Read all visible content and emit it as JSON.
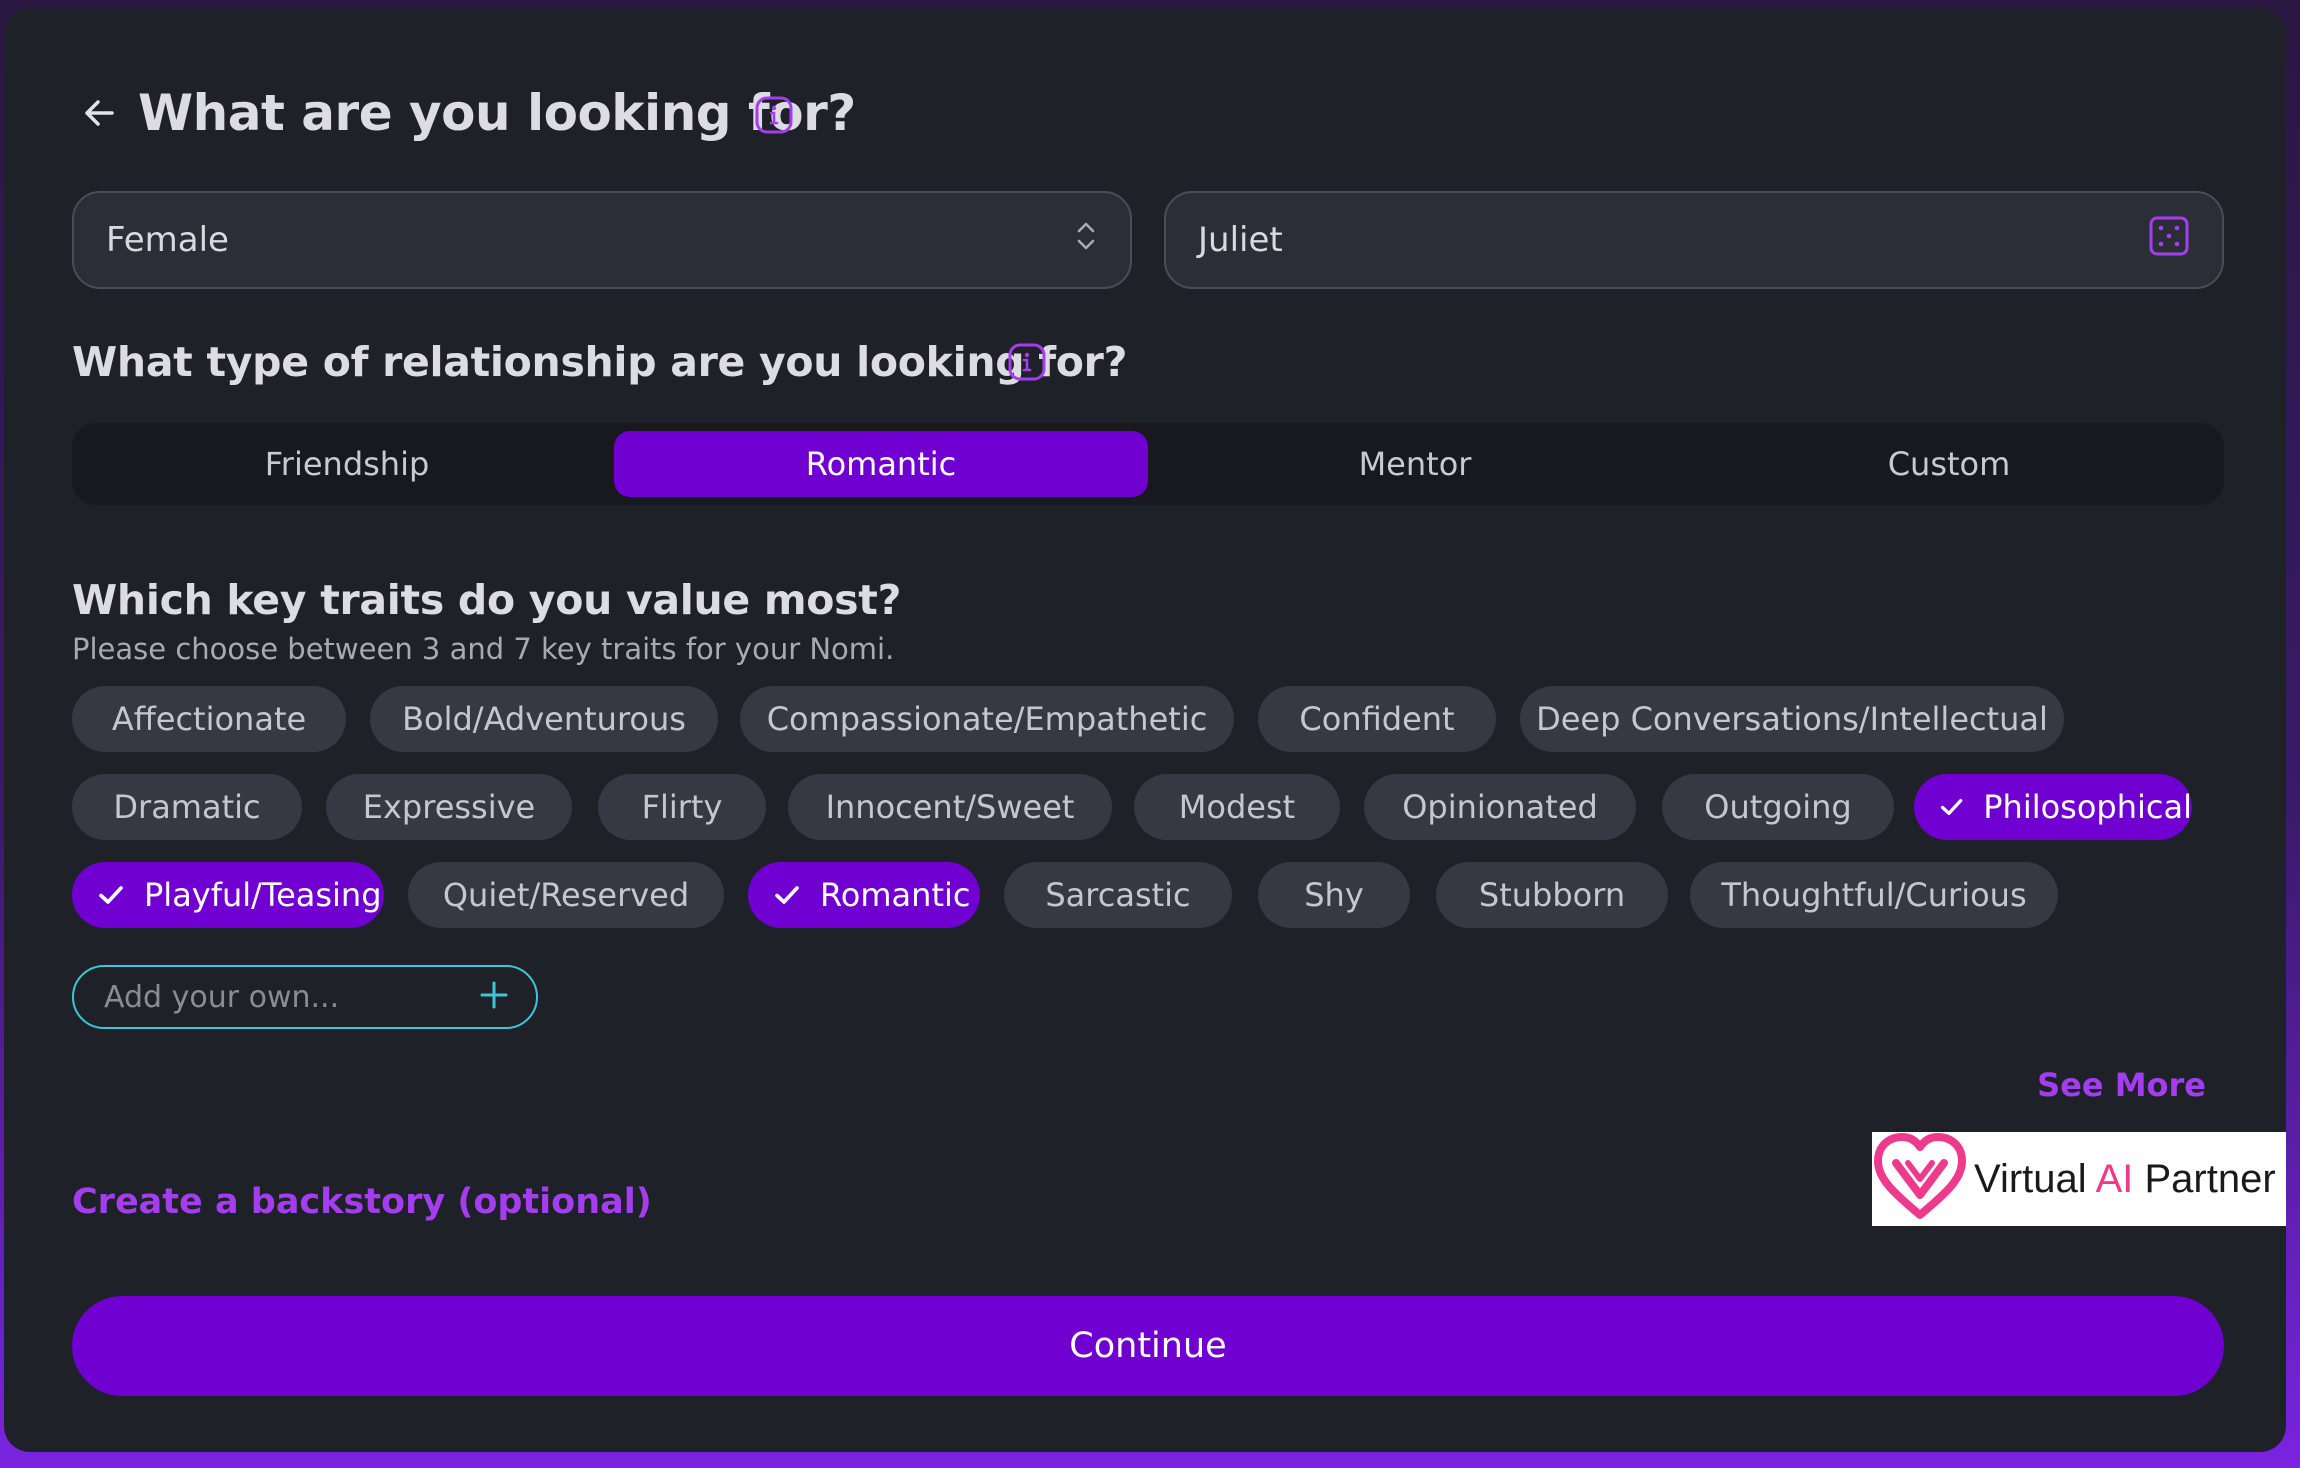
{
  "header": {
    "title": "What are you looking for?",
    "back_icon": "arrow-left-icon",
    "info_icon": "info-icon"
  },
  "gender": {
    "value": "Female",
    "icon": "chevron-up-down-icon"
  },
  "name": {
    "value": "Juliet",
    "icon": "dice-icon"
  },
  "relationship": {
    "title": "What type of relationship are you looking for?",
    "options": [
      "Friendship",
      "Romantic",
      "Mentor",
      "Custom"
    ],
    "selected": "Romantic"
  },
  "traits": {
    "title": "Which key traits do you value most?",
    "subtitle": "Please choose between 3 and 7 key traits for your Nomi.",
    "items": [
      {
        "label": "Affectionate",
        "selected": false
      },
      {
        "label": "Bold/Adventurous",
        "selected": false
      },
      {
        "label": "Compassionate/Empathetic",
        "selected": false
      },
      {
        "label": "Confident",
        "selected": false
      },
      {
        "label": "Deep Conversations/Intellectual",
        "selected": false
      },
      {
        "label": "Dramatic",
        "selected": false
      },
      {
        "label": "Expressive",
        "selected": false
      },
      {
        "label": "Flirty",
        "selected": false
      },
      {
        "label": "Innocent/Sweet",
        "selected": false
      },
      {
        "label": "Modest",
        "selected": false
      },
      {
        "label": "Opinionated",
        "selected": false
      },
      {
        "label": "Outgoing",
        "selected": false
      },
      {
        "label": "Philosophical",
        "selected": true
      },
      {
        "label": "Playful/Teasing",
        "selected": true
      },
      {
        "label": "Quiet/Reserved",
        "selected": false
      },
      {
        "label": "Romantic",
        "selected": true
      },
      {
        "label": "Sarcastic",
        "selected": false
      },
      {
        "label": "Shy",
        "selected": false
      },
      {
        "label": "Stubborn",
        "selected": false
      },
      {
        "label": "Thoughtful/Curious",
        "selected": false
      }
    ],
    "add_placeholder": "Add your own...",
    "see_more": "See More"
  },
  "backstory_link": "Create a backstory (optional)",
  "watermark": {
    "text_before": "Virtual ",
    "text_ai": "AI",
    "text_after": " Partner",
    "icon": "heart-logo-icon"
  },
  "continue_label": "Continue",
  "colors": {
    "accent": "#7000d1",
    "link": "#a43df0",
    "card": "#1f2128",
    "chip": "#363944",
    "input_focus": "#3cc7d6"
  }
}
